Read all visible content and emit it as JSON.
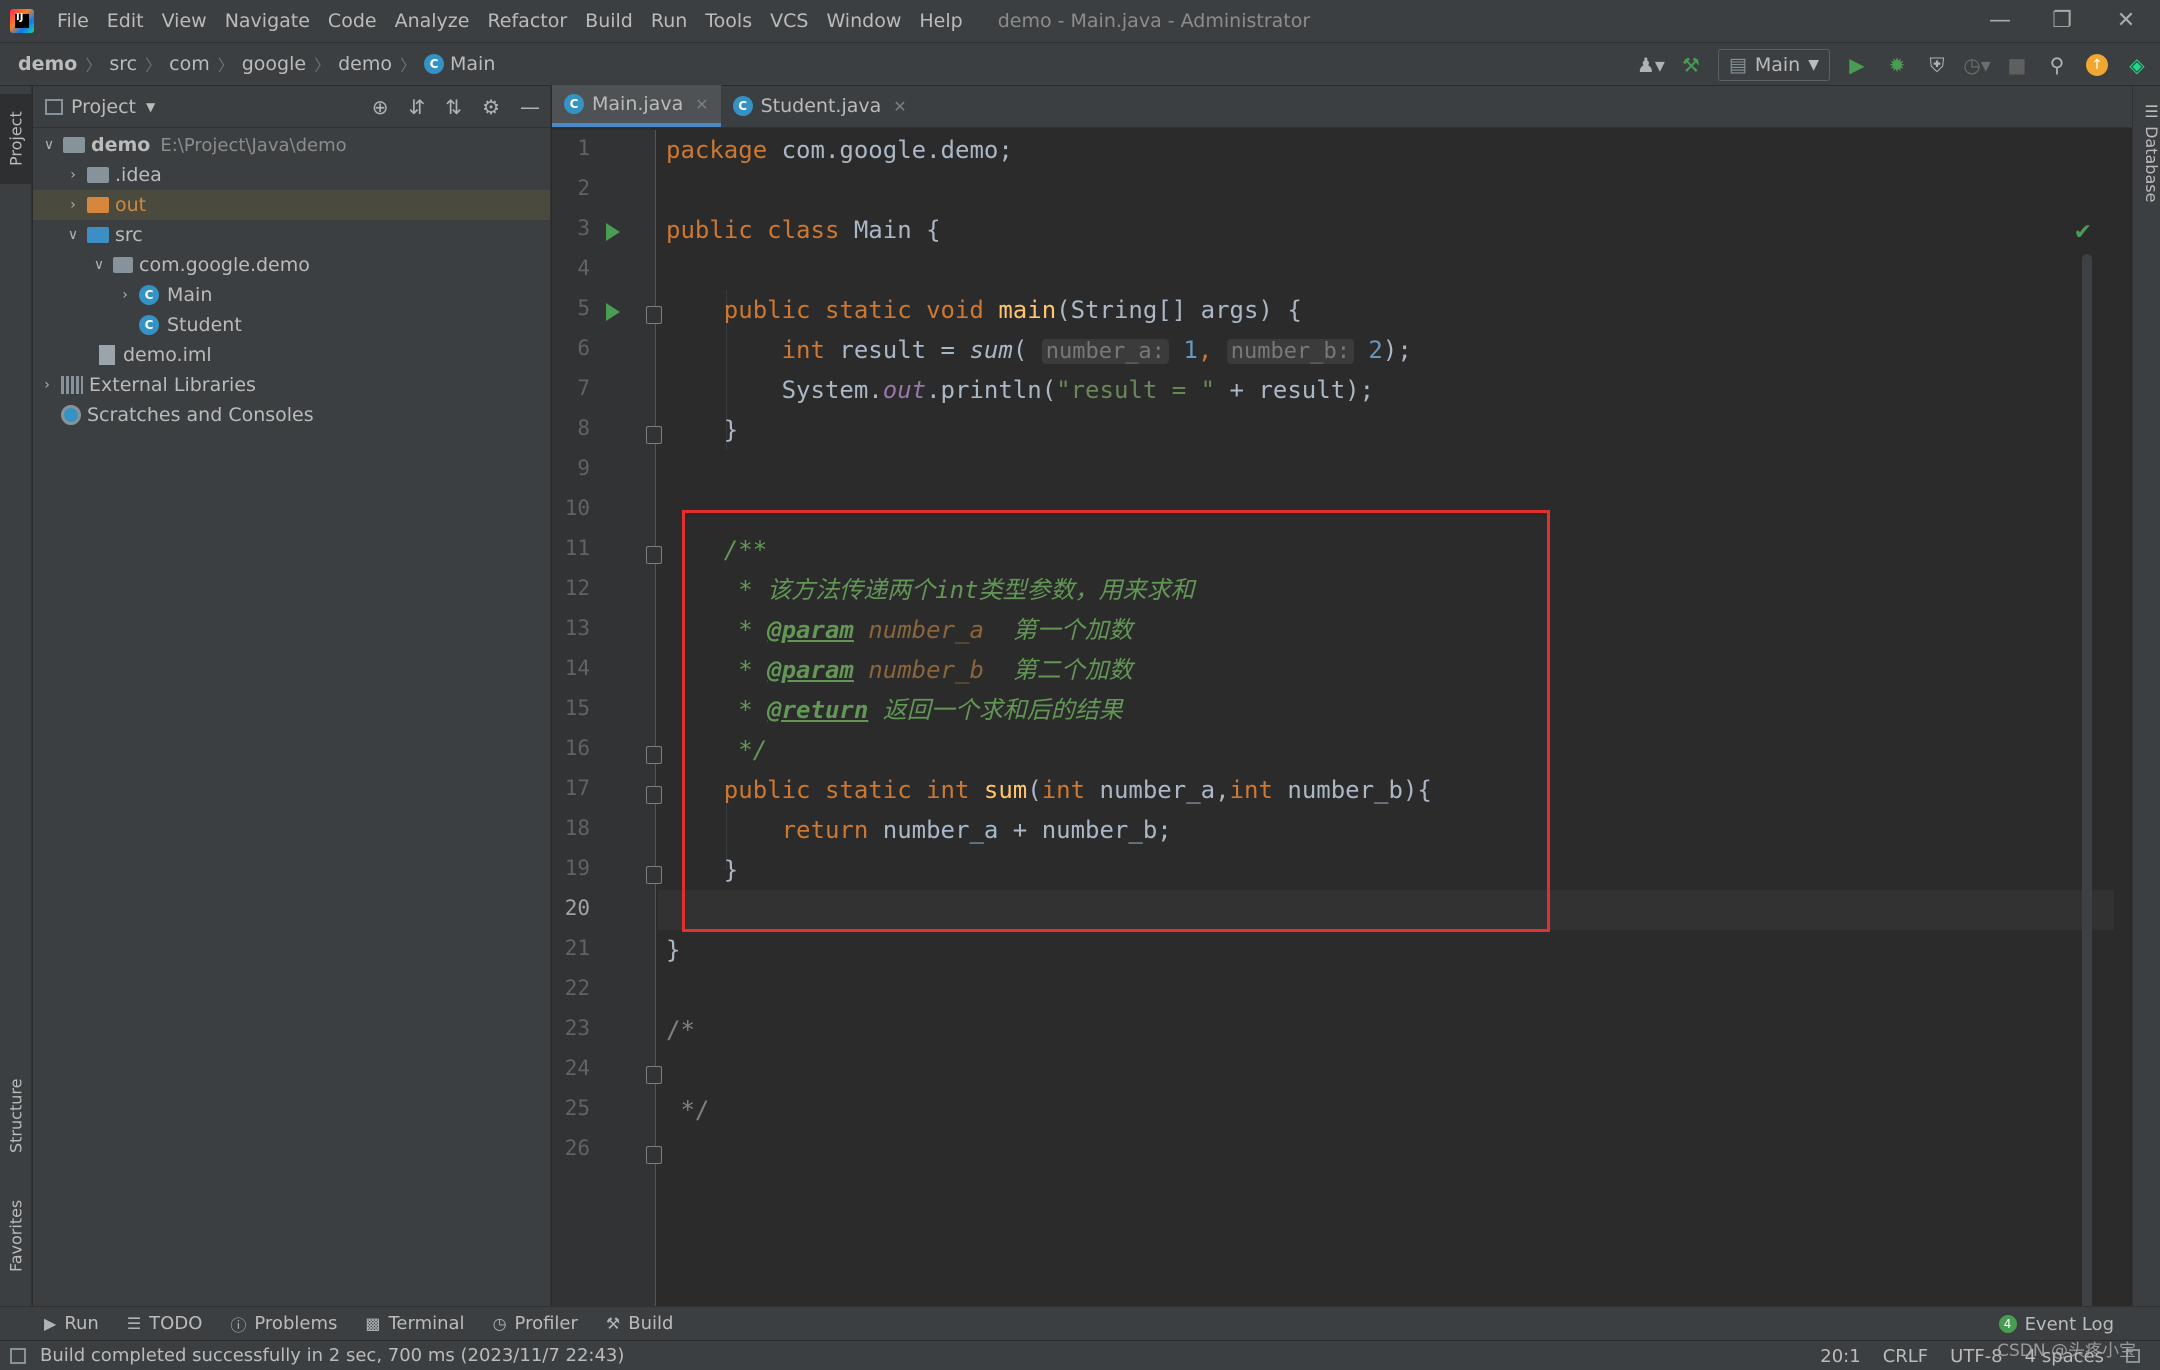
{
  "menu": {
    "items": [
      "File",
      "Edit",
      "View",
      "Navigate",
      "Code",
      "Analyze",
      "Refactor",
      "Build",
      "Run",
      "Tools",
      "VCS",
      "Window",
      "Help"
    ],
    "window_title": "demo - Main.java - Administrator"
  },
  "breadcrumbs": [
    "demo",
    "src",
    "com",
    "google",
    "demo",
    "Main"
  ],
  "toolbar": {
    "run_config": "Main"
  },
  "left_stripe": {
    "project": "Project",
    "structure": "Structure",
    "favorites": "Favorites"
  },
  "right_stripe": {
    "database": "Database"
  },
  "project_panel": {
    "title": "Project",
    "tree": [
      {
        "label": "demo",
        "path": "E:\\Project\\Java\\demo"
      },
      {
        "label": ".idea"
      },
      {
        "label": "out"
      },
      {
        "label": "src"
      },
      {
        "label": "com.google.demo"
      },
      {
        "label": "Main"
      },
      {
        "label": "Student"
      },
      {
        "label": "demo.iml"
      },
      {
        "label": "External Libraries"
      },
      {
        "label": "Scratches and Consoles"
      }
    ]
  },
  "editor": {
    "tabs": [
      {
        "label": "Main.java",
        "active": true
      },
      {
        "label": "Student.java",
        "active": false
      }
    ],
    "line_numbers": [
      "1",
      "2",
      "3",
      "4",
      "5",
      "6",
      "7",
      "8",
      "9",
      "10",
      "11",
      "12",
      "13",
      "14",
      "15",
      "16",
      "17",
      "18",
      "19",
      "20",
      "21",
      "22",
      "23",
      "24",
      "25",
      "26"
    ],
    "current_line": "20",
    "code": {
      "l1_kw": "package",
      "l1_rest": " com.google.demo;",
      "l3_kw": "public class",
      "l3_rest": " Main {",
      "l5_kw1": "public static void",
      "l5_fn": "main",
      "l5_rest": "(String[] args) {",
      "l6_kw": "int",
      "l6_a": " result = ",
      "l6_fn": "sum",
      "l6_hint_a": "number_a:",
      "l6_num_a": "1",
      "l6_hint_b": "number_b:",
      "l6_num_b": "2",
      "l6_end": ");",
      "l7_a": "System.",
      "l7_field": "out",
      "l7_b": ".println(",
      "l7_str": "\"result = \"",
      "l7_c": " + result);",
      "l8": "}",
      "l11": "/**",
      "l12": " * 该方法传递两个int类型参数，用来求和",
      "l13_star": " * ",
      "l13_tag": "@param",
      "l13_param": " number_a ",
      "l13_desc": " 第一个加数",
      "l14_star": " * ",
      "l14_tag": "@param",
      "l14_param": " number_b ",
      "l14_desc": " 第二个加数",
      "l15_star": " * ",
      "l15_tag": "@return",
      "l15_desc": " 返回一个求和后的结果",
      "l16": " */",
      "l17_kw": "public static int",
      "l17_fn": "sum",
      "l17_a": "(",
      "l17_kw2": "int",
      "l17_b": " number_a,",
      "l17_kw3": "int",
      "l17_c": " number_b){",
      "l18_kw": "return",
      "l18_rest": " number_a + number_b;",
      "l19": "}",
      "l21": "}",
      "l23": "/*",
      "l25": " */"
    }
  },
  "bottom_tools": [
    "Run",
    "TODO",
    "Problems",
    "Terminal",
    "Profiler",
    "Build"
  ],
  "event_log": {
    "label": "Event Log",
    "count": "4"
  },
  "status": {
    "message": "Build completed successfully in 2 sec, 700 ms (2023/11/7 22:43)",
    "position": "20:1",
    "line_sep": "CRLF",
    "encoding": "UTF-8",
    "indent": "4 spaces"
  },
  "watermark": "CSDN @头疼小宝",
  "colors": {
    "highlight_box": "#e0312f",
    "keyword": "#cc7832",
    "function": "#ffc66d",
    "string": "#6a8759",
    "doc_comment": "#629755"
  }
}
